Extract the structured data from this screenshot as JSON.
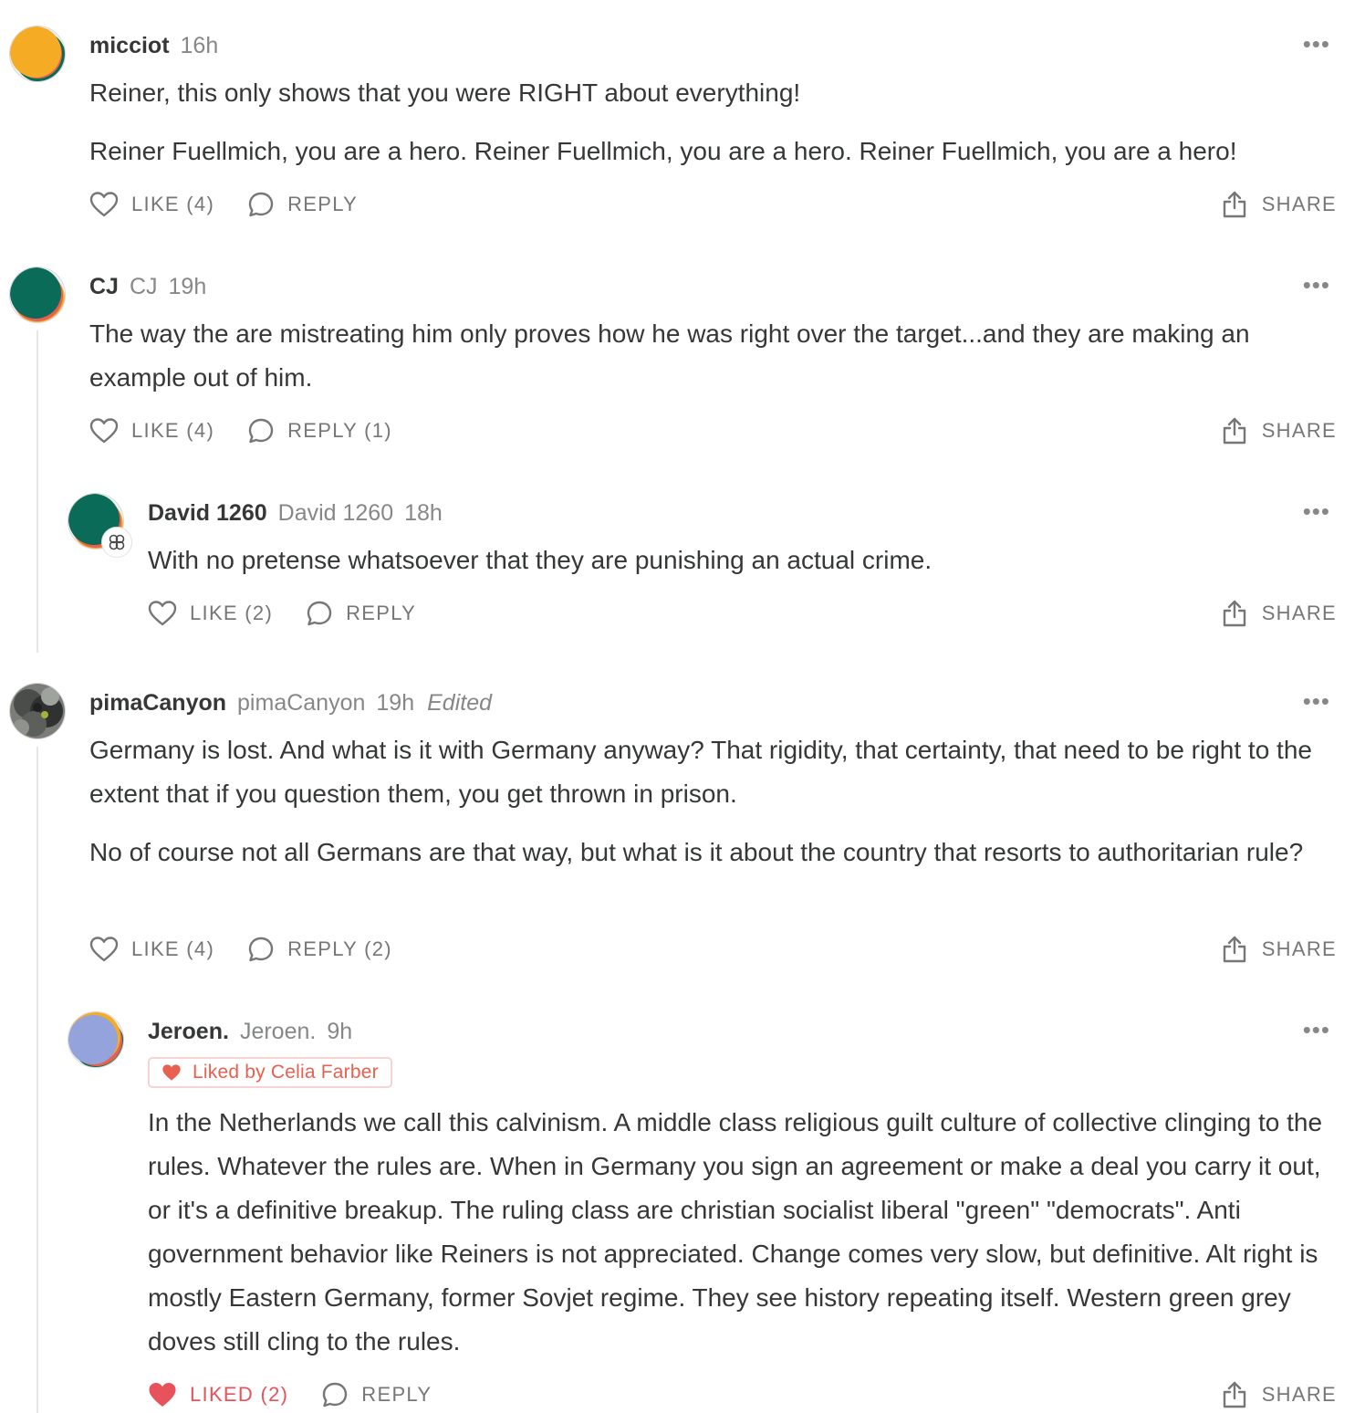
{
  "comments": [
    {
      "name": "micciot",
      "time": "16h",
      "paragraphs": [
        "Reiner, this only shows that you were RIGHT about everything!",
        "Reiner Fuellmich, you are a hero. Reiner Fuellmich, you are a hero. Reiner Fuellmich, you are a hero!"
      ],
      "like_label": "LIKE (4)",
      "reply_label": "REPLY",
      "share_label": "SHARE"
    },
    {
      "name": "CJ",
      "handle": "CJ",
      "time": "19h",
      "paragraphs": [
        "The way the are mistreating him only proves how he was right over the target...and they are making an example out of him."
      ],
      "like_label": "LIKE (4)",
      "reply_label": "REPLY (1)",
      "share_label": "SHARE"
    },
    {
      "name": "David 1260",
      "handle": "David 1260",
      "time": "18h",
      "paragraphs": [
        "With no pretense whatsoever that they are punishing an actual crime."
      ],
      "like_label": "LIKE (2)",
      "reply_label": "REPLY",
      "share_label": "SHARE"
    },
    {
      "name": "pimaCanyon",
      "handle": "pimaCanyon",
      "time": "19h",
      "edited": "Edited",
      "paragraphs": [
        "Germany is lost. And what is it with Germany anyway? That rigidity, that certainty, that need to be right to the extent that if you question them, you get thrown in prison.",
        "No of course not all Germans are that way, but what is it about the country that resorts to authoritarian rule?"
      ],
      "like_label": "LIKE (4)",
      "reply_label": "REPLY (2)",
      "share_label": "SHARE"
    },
    {
      "name": "Jeroen.",
      "handle": "Jeroen.",
      "time": "9h",
      "liked_by": "Liked by Celia Farber",
      "paragraphs": [
        "In the Netherlands we call this calvinism. A middle class religious guilt culture of collective clinging to the rules. Whatever the rules are. When in Germany you sign an agreement or make a deal you carry it out, or it's a definitive breakup. The ruling class are christian socialist liberal \"green\" \"democrats\". Anti government behavior like Reiners is not appreciated. Change comes very slow, but definitive. Alt right is mostly Eastern Germany, former Sovjet regime. They see history repeating itself. Western green grey doves still cling to the rules."
      ],
      "like_label": "LIKED (2)",
      "reply_label": "REPLY",
      "share_label": "SHARE"
    }
  ],
  "more_symbol": "•••",
  "colors": {
    "text": "#363737",
    "muted": "#868787",
    "liked": "#e8525a",
    "accent_orange": "#f5a623",
    "accent_green": "#0a6b58",
    "accent_periwinkle": "#94a3db"
  },
  "icons": [
    "more-icon",
    "heart-icon",
    "heart-filled-icon",
    "reply-bubble-icon",
    "share-icon",
    "badge-icon"
  ]
}
